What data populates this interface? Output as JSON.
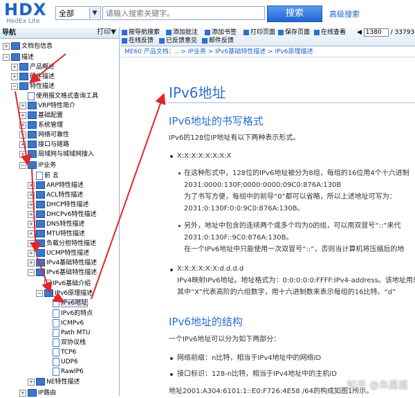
{
  "header": {
    "logo_text": "HDX",
    "logo_sub": "HedEx Lite",
    "scope_value": "全部",
    "search_placeholder": "请输入搜索关键字。",
    "search_button": "搜索",
    "advanced_search": "高级搜索"
  },
  "nav": {
    "title": "导航",
    "print": "打印▼",
    "items": [
      "文档包信息",
      "描述",
      "产品概述",
      "硬件描述",
      "特性描述",
      "使用报文格式查询工具",
      "VRP特性简介",
      "基础配置",
      "系统管理",
      "网络可靠性",
      "接口与链路",
      "局域网与城域网接入",
      "IP业务",
      "前 言",
      "ARP特性描述",
      "ACL特性描述",
      "DHCP特性描述",
      "DHCPv6特性描述",
      "DNS特性描述",
      "MTU特性描述",
      "负载分担特性描述",
      "UCMP特性描述",
      "IPv4基础特性描述",
      "IPv6基础特性描述",
      "IPv6基础介绍",
      "IPv6原理描述",
      "IPv6地址",
      "IPv6的特点",
      "ICMPv6",
      "Path  MTU",
      "双协议栈",
      "TCP6",
      "UDP6",
      "RawIP6",
      "NE特性描述",
      "IP路由"
    ]
  },
  "toolbar": {
    "nav_search": "按导航搜索",
    "add_note": "添加批注",
    "add_bookmark": "添加书签",
    "print_page": "打印页面",
    "save_page": "保存页面",
    "online_view": "在线查看",
    "page_current": "1380",
    "page_total": "/ 33793",
    "online_feedback": "在线反馈",
    "feedback_opinion": "已反馈意见",
    "email_feedback": "邮件反馈"
  },
  "breadcrumb": "ME60 产品文档：.. > IP业务 > IPv6基础特性描述 > IPv6原理描述",
  "content": {
    "title": "IPv6地址",
    "section1_title": "IPv6地址的书写格式",
    "section1_intro": "IPv6的128位IP地址有以下两种表示形式。",
    "form1": "X:X:X:X:X:X:X:X",
    "form1_desc_1": "在这种形式中，128位的IPv6地址被分为8组，每组的16位用4个十六进制",
    "form1_desc_2": "2031:0000:130F:0000:0000:09C0:876A:130B",
    "form1_desc_3": "为了书写方便，每组中的前导“0”都可以省略，所以上述地址可写为：",
    "form1_desc_4": "2031:0:130F:0:0:9C0:876A:130B。",
    "form1_desc_5": "另外，地址中包含的连续两个或多个均为0的组，可以用双冒号“::”来代",
    "form1_desc_6": "2031:0:130F::9C0:876A:130B。",
    "form1_desc_7": "在一个IPv6地址中只能使用一次双冒号“::”，否则当计算机将压缩后的地",
    "form2": "X:X:X:X:X:X:d.d.d.d",
    "form2_desc_1": "IPv4映射IPv6地址。地址格式为：0:0:0:0:0:FFFF:IPv4-address。该地址用来",
    "form2_desc_2": "其中“X”代表高阶的六组数字，用十六进制数来表示每组的16比特。“d”",
    "section2_title": "IPv6地址的结构",
    "section2_intro": "一个IPv6地址可以分为如下两部分：",
    "part1": "网络前缀：n比特，相当于IPv4地址中的网络ID",
    "part2": "接口标识：128-n比特，相当于IPv4地址中的主机ID",
    "example": "地址2001:A304:6101:1::E0:F726:4E58 /64的构成如图1所示。",
    "watermark": "知乎 @朱嘉盛"
  }
}
